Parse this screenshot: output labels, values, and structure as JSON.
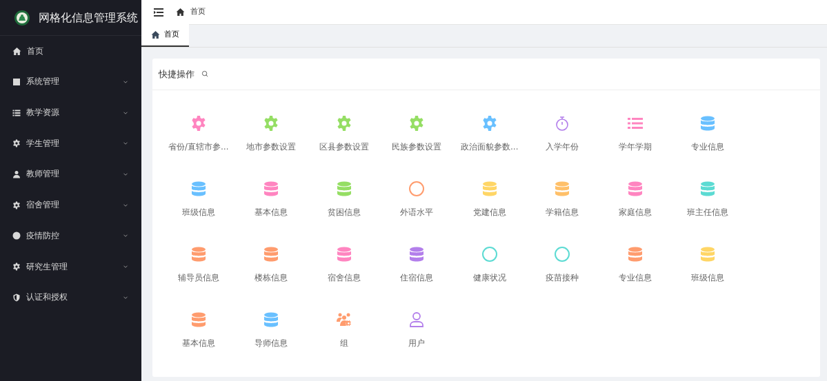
{
  "app": {
    "title": "网格化信息管理系统"
  },
  "sidebar": {
    "items": [
      {
        "label": "首页",
        "kind": "link"
      },
      {
        "label": "系统管理",
        "kind": "menu",
        "expanded": false
      },
      {
        "label": "教学资源",
        "kind": "menu",
        "expanded": false
      },
      {
        "label": "学生管理",
        "kind": "menu",
        "expanded": false
      },
      {
        "label": "教师管理",
        "kind": "menu",
        "expanded": false
      },
      {
        "label": "宿舍管理",
        "kind": "menu",
        "expanded": false
      },
      {
        "label": "疫情防控",
        "kind": "menu",
        "expanded": false
      },
      {
        "label": "研究生管理",
        "kind": "menu",
        "expanded": false
      },
      {
        "label": "认证和授权",
        "kind": "menu",
        "expanded": false
      }
    ]
  },
  "header": {
    "breadcrumb": "首页"
  },
  "tabs": [
    {
      "label": "首页",
      "selected": true
    }
  ],
  "quick_actions": {
    "title": "快捷操作",
    "items": [
      {
        "label": "省份/直辖市参…",
        "kind": "gear",
        "color": "#ff85c0"
      },
      {
        "label": "地市参数设置",
        "kind": "gear",
        "color": "#95de64"
      },
      {
        "label": "区县参数设置",
        "kind": "gear",
        "color": "#95de64"
      },
      {
        "label": "民族参数设置",
        "kind": "gear",
        "color": "#95de64"
      },
      {
        "label": "政治面貌参数…",
        "kind": "gear",
        "color": "#69c0ff"
      },
      {
        "label": "入学年份",
        "kind": "timer",
        "color": "#b37feb"
      },
      {
        "label": "学年学期",
        "kind": "list",
        "color": "#ff85c0"
      },
      {
        "label": "专业信息",
        "kind": "database",
        "color": "#69c0ff"
      },
      {
        "label": "班级信息",
        "kind": "database",
        "color": "#69c0ff"
      },
      {
        "label": "基本信息",
        "kind": "database",
        "color": "#ff85c0"
      },
      {
        "label": "贫困信息",
        "kind": "database",
        "color": "#95de64"
      },
      {
        "label": "外语水平",
        "kind": "ring",
        "color": "#ff9c6e"
      },
      {
        "label": "党建信息",
        "kind": "database",
        "color": "#ffd666"
      },
      {
        "label": "学籍信息",
        "kind": "database",
        "color": "#ffc069"
      },
      {
        "label": "家庭信息",
        "kind": "database",
        "color": "#ff85c0"
      },
      {
        "label": "班主任信息",
        "kind": "database",
        "color": "#5cdbd3"
      },
      {
        "label": "辅导员信息",
        "kind": "database",
        "color": "#ff9c6e"
      },
      {
        "label": "楼栋信息",
        "kind": "database",
        "color": "#ff9c6e"
      },
      {
        "label": "宿舍信息",
        "kind": "database",
        "color": "#ff85c0"
      },
      {
        "label": "住宿信息",
        "kind": "database",
        "color": "#b37feb"
      },
      {
        "label": "健康状况",
        "kind": "ring",
        "color": "#5cdbd3"
      },
      {
        "label": "疫苗接种",
        "kind": "ring",
        "color": "#5cdbd3"
      },
      {
        "label": "专业信息",
        "kind": "database",
        "color": "#ff9c6e"
      },
      {
        "label": "班级信息",
        "kind": "database",
        "color": "#ffd666"
      },
      {
        "label": "基本信息",
        "kind": "database",
        "color": "#ff9c6e"
      },
      {
        "label": "导师信息",
        "kind": "database",
        "color": "#69c0ff"
      },
      {
        "label": "组",
        "kind": "group",
        "color": "#ff9c6e"
      },
      {
        "label": "用户",
        "kind": "user",
        "color": "#b37feb"
      }
    ]
  }
}
